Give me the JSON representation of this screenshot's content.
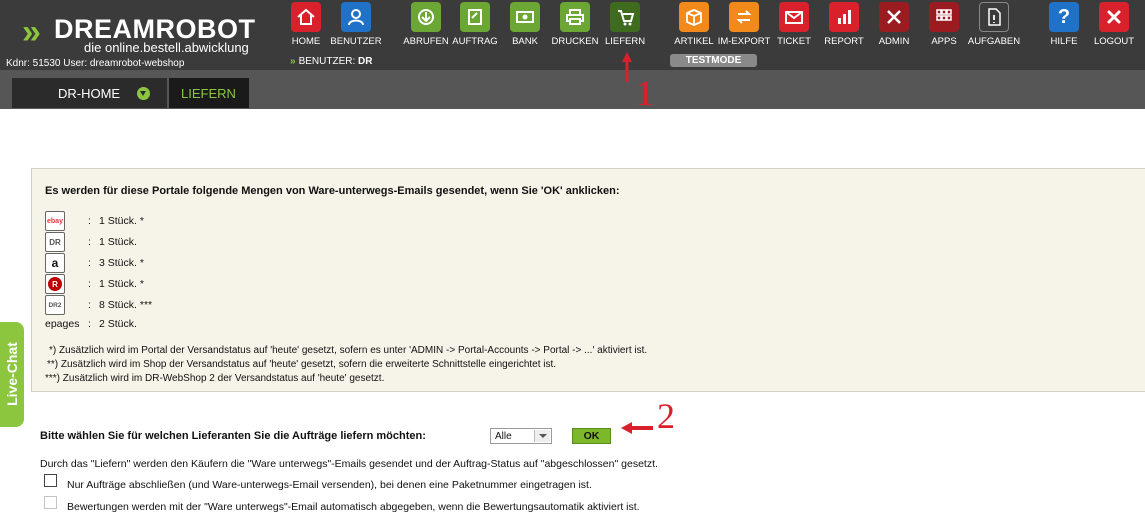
{
  "header": {
    "brand": "DREAMROBOT",
    "slogan": "die online.bestell.abwicklung",
    "kdnr_line": "Kdnr: 51530  User: dreamrobot-webshop",
    "benutzer_label": "BENUTZER:",
    "benutzer_value": "DR",
    "testmode": "TESTMODE",
    "nav": [
      {
        "label": "HOME",
        "icon": "home-icon",
        "color": "#d9212b"
      },
      {
        "label": "BENUTZER",
        "icon": "user-icon",
        "color": "#1f72c8"
      },
      {
        "label": "ABRUFEN",
        "icon": "download-icon",
        "color": "#6ca634"
      },
      {
        "label": "AUFTRAG",
        "icon": "order-icon",
        "color": "#6ca634"
      },
      {
        "label": "BANK",
        "icon": "money-icon",
        "color": "#6ca634"
      },
      {
        "label": "DRUCKEN",
        "icon": "printer-icon",
        "color": "#6ca634"
      },
      {
        "label": "LIEFERN",
        "icon": "cart-icon",
        "color": "#3f6b1f"
      },
      {
        "label": "ARTIKEL",
        "icon": "box-icon",
        "color": "#f28a1b"
      },
      {
        "label": "IM-EXPORT",
        "icon": "swap-icon",
        "color": "#f28a1b"
      },
      {
        "label": "TICKET",
        "icon": "envelope-icon",
        "color": "#d9212b"
      },
      {
        "label": "REPORT",
        "icon": "bar-chart-icon",
        "color": "#d9212b"
      },
      {
        "label": "ADMIN",
        "icon": "tools-icon",
        "color": "#9b1c20"
      },
      {
        "label": "APPS",
        "icon": "grid-icon",
        "color": "#9b1c20"
      },
      {
        "label": "AUFGABEN",
        "icon": "task-icon",
        "color": "#3b3b3b"
      },
      {
        "label": "HILFE",
        "icon": "help-icon",
        "color": "#1f72c8"
      },
      {
        "label": "LOGOUT",
        "icon": "logout-icon",
        "color": "#d9212b"
      }
    ]
  },
  "tabs": {
    "home": "DR-HOME",
    "liefern": "LIEFERN"
  },
  "panel": {
    "intro": "Es werden für diese Portale folgende Mengen von Ware-unterwegs-Emails gesendet, wenn Sie 'OK' anklicken:",
    "portals": [
      {
        "icon": "ebay-icon",
        "icon_text": "ebay",
        "qty": "1 Stück. *"
      },
      {
        "icon": "dr-icon",
        "icon_text": "DR",
        "qty": "1 Stück."
      },
      {
        "icon": "amazon-icon",
        "icon_text": "a",
        "qty": "3 Stück. *"
      },
      {
        "icon": "rakuten-icon",
        "icon_text": "R",
        "qty": "1 Stück. *"
      },
      {
        "icon": "dr2-webshop-icon",
        "icon_text": "DR2",
        "qty": "8 Stück. ***"
      }
    ],
    "epages": {
      "name": "epages",
      "qty": "2 Stück."
    },
    "notes": [
      "*) Zusätzlich wird im Portal der Versandstatus auf 'heute' gesetzt, sofern es unter 'ADMIN -> Portal-Accounts -> Portal -> ...' aktiviert ist.",
      "**) Zusätzlich wird im Shop der Versandstatus auf 'heute' gesetzt, sofern die erweiterte Schnittstelle eingerichtet ist.",
      "***) Zusätzlich wird im DR-WebShop 2 der Versandstatus auf 'heute' gesetzt."
    ]
  },
  "livechat": "Live-Chat",
  "form": {
    "question": "Bitte wählen Sie für welchen Lieferanten Sie die Aufträge liefern möchten:",
    "select_value": "Alle",
    "ok": "OK",
    "info": "Durch das \"Liefern\" werden den Käufern die \"Ware unterwegs\"-Emails gesendet und der Auftrag-Status auf \"abgeschlossen\" gesetzt.",
    "checkbox1": "Nur Aufträge abschließen (und Ware-unterwegs-Email versenden), bei denen eine Paketnummer eingetragen ist.",
    "checkbox2": "Bewertungen werden mit der \"Ware unterwegs\"-Email automatisch abgegeben, wenn die Bewertungsautomatik aktiviert ist."
  },
  "annotations": {
    "one": "1",
    "two": "2",
    "color": "#d9212b"
  }
}
